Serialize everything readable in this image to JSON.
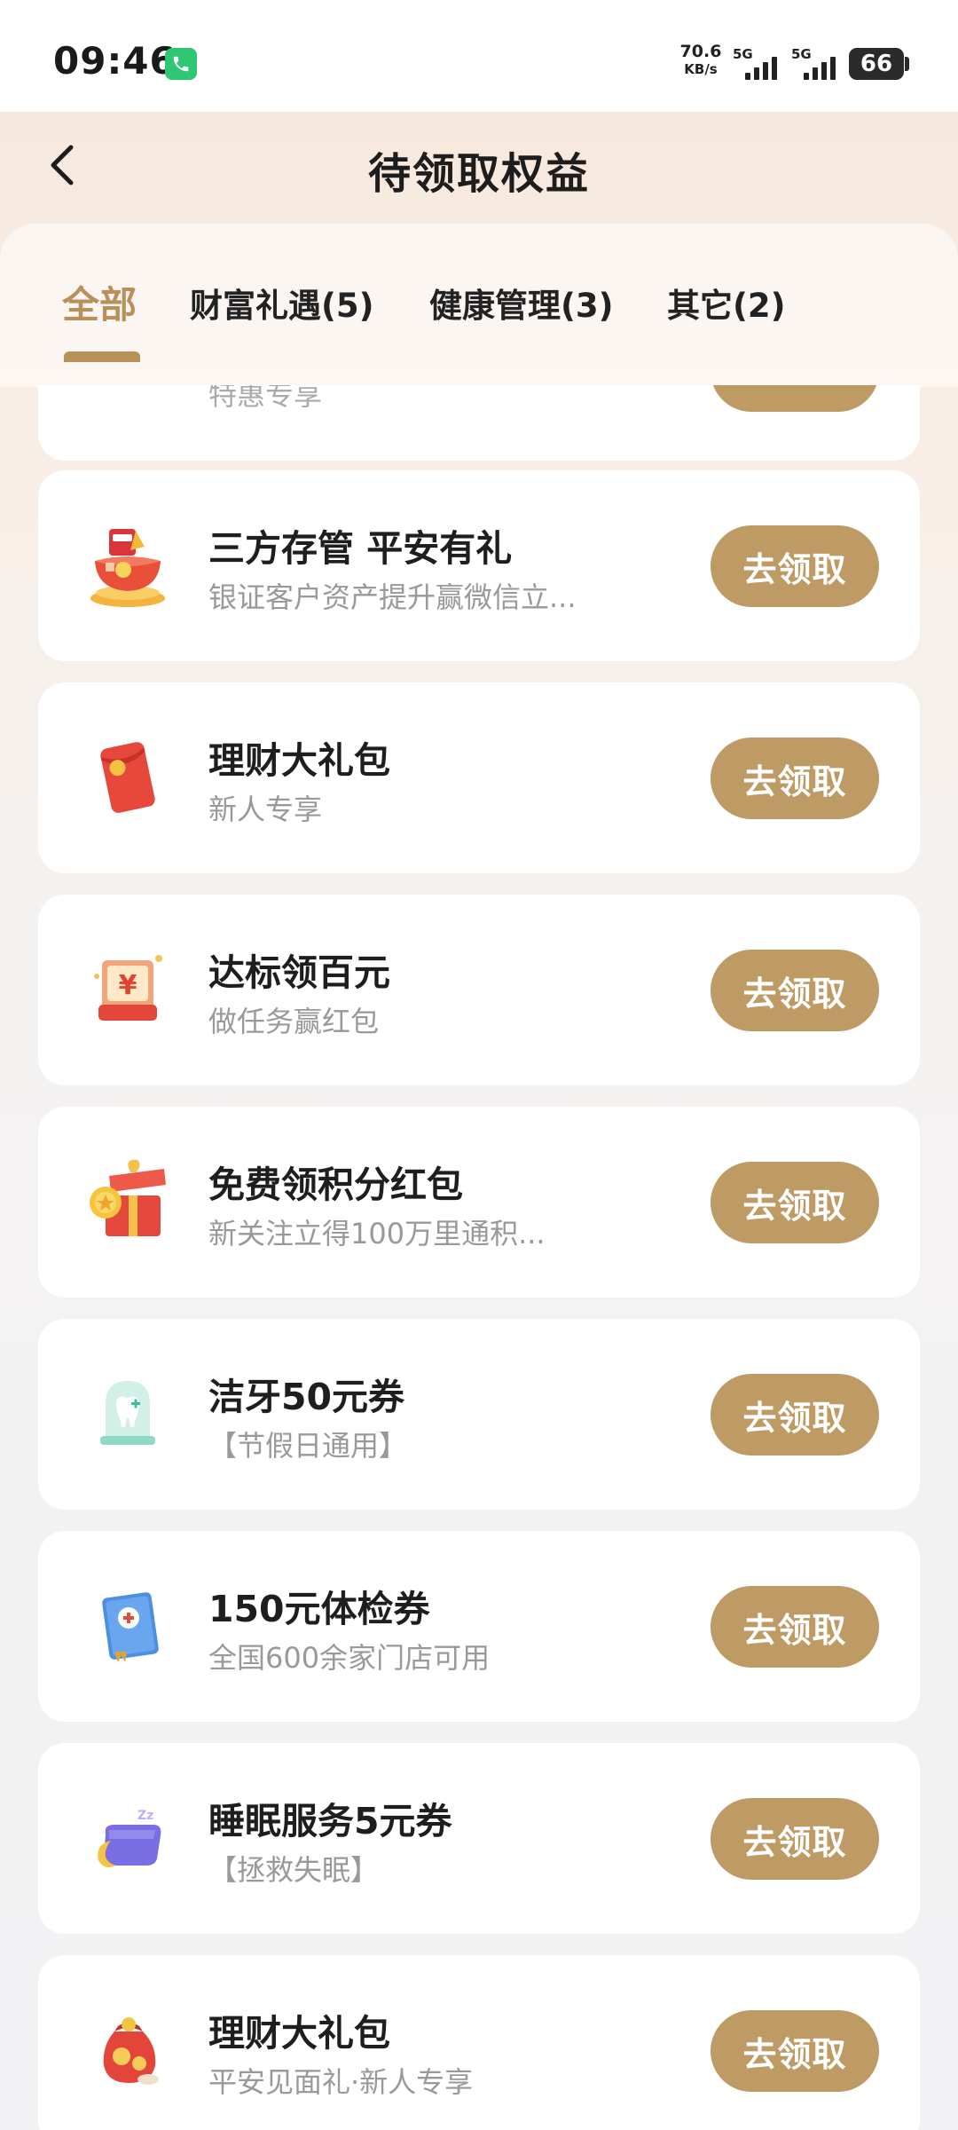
{
  "status_bar": {
    "time": "09:46",
    "net_speed_value": "70.6",
    "net_speed_unit": "KB/s",
    "sim1_label": "5G",
    "sim2_label": "5G",
    "battery": "66",
    "call_icon": "phone-icon",
    "accent_green": "#2fc774"
  },
  "header": {
    "title": "待领取权益",
    "back_icon": "chevron-left-icon"
  },
  "tabs": [
    {
      "label": "全部",
      "active": true
    },
    {
      "label": "财富礼遇(5)",
      "active": false
    },
    {
      "label": "健康管理(3)",
      "active": false
    },
    {
      "label": "其它(2)",
      "active": false
    }
  ],
  "colors": {
    "accent": "#be9a64",
    "active_tab": "#b8905a",
    "subtitle": "#999999"
  },
  "partial_card": {
    "subtitle": "特惠专享"
  },
  "cards": [
    {
      "title": "三方存管 平安有礼",
      "subtitle": "银证客户资产提升赢微信立...",
      "button": "去领取",
      "icon": "gift-basket-icon"
    },
    {
      "title": "理财大礼包",
      "subtitle": "新人专享",
      "button": "去领取",
      "icon": "red-envelope-icon"
    },
    {
      "title": "达标领百元",
      "subtitle": "做任务赢红包",
      "button": "去领取",
      "icon": "yuan-box-icon"
    },
    {
      "title": "免费领积分红包",
      "subtitle": "新关注立得100万里通积...",
      "button": "去领取",
      "icon": "open-gift-box-icon"
    },
    {
      "title": "洁牙50元券",
      "subtitle": "【节假日通用】",
      "button": "去领取",
      "icon": "tooth-dome-icon"
    },
    {
      "title": "150元体检券",
      "subtitle": "全国600余家门店可用",
      "button": "去领取",
      "icon": "medical-book-icon"
    },
    {
      "title": "睡眠服务5元券",
      "subtitle": "【拯救失眠】",
      "button": "去领取",
      "icon": "moon-pillow-icon"
    },
    {
      "title": "理财大礼包",
      "subtitle": "平安见面礼·新人专享",
      "button": "去领取",
      "icon": "money-bag-icon"
    }
  ]
}
